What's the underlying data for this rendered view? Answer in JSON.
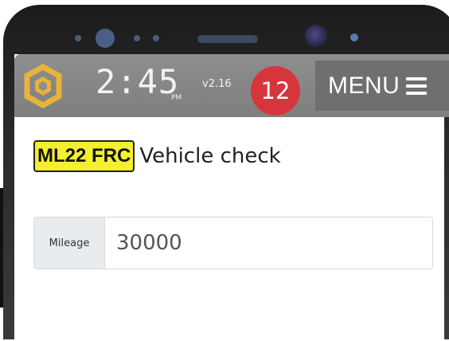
{
  "appbar": {
    "time": "2:45",
    "ampm": "PM",
    "version": "v2.16",
    "notification_count": "12",
    "menu_label": "MENU",
    "logo_icon": "hexagon-logo-icon",
    "menu_icon": "hamburger-icon"
  },
  "vehicle": {
    "registration": "ML22 FRC",
    "page_title": "Vehicle check"
  },
  "mileage": {
    "label": "Mileage",
    "value": "30000"
  },
  "colors": {
    "appbar_bg": "#8e8e8e",
    "badge_bg": "#d7353d",
    "plate_bg": "#f4ef2f",
    "logo_gold": "#e8b33b"
  }
}
